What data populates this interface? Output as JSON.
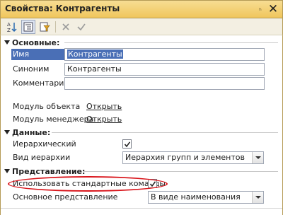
{
  "window": {
    "title": "Свойства: Контрагенты",
    "pin_glyph": "ₕ",
    "close_glyph": "✕"
  },
  "toolbar": {
    "buttons": [
      {
        "icon": "sort-alphabetical-icon"
      },
      {
        "icon": "categorized-view-icon"
      },
      {
        "icon": "filter-icon"
      },
      {
        "icon": "cancel-icon"
      },
      {
        "icon": "apply-checkmark-icon"
      }
    ]
  },
  "sections": {
    "basic": "Основные:",
    "data": "Данные:",
    "presentation": "Представление:"
  },
  "fields": {
    "name_label": "Имя",
    "name_value": "Контрагенты",
    "synonym_label": "Синоним",
    "synonym_value": "Контрагенты",
    "comment_label": "Комментарий",
    "comment_value": "",
    "object_module_label": "Модуль объекта",
    "object_module_link": "Открыть",
    "manager_module_label": "Модуль менеджера",
    "manager_module_link": "Открыть",
    "hierarchical_label": "Иерархический",
    "hierarchical_checked": true,
    "hierarchy_type_label": "Вид иерархии",
    "hierarchy_type_value": "Иерархия групп и элементов",
    "use_standard_commands_label": "Использовать стандартные команды",
    "use_standard_commands_checked": true,
    "main_presentation_label": "Основное представление",
    "main_presentation_value": "В виде наименования"
  },
  "colors": {
    "titlebar": "#f0c65c",
    "selection": "#4a6fb6",
    "annotation_ellipse": "#d9151b"
  }
}
